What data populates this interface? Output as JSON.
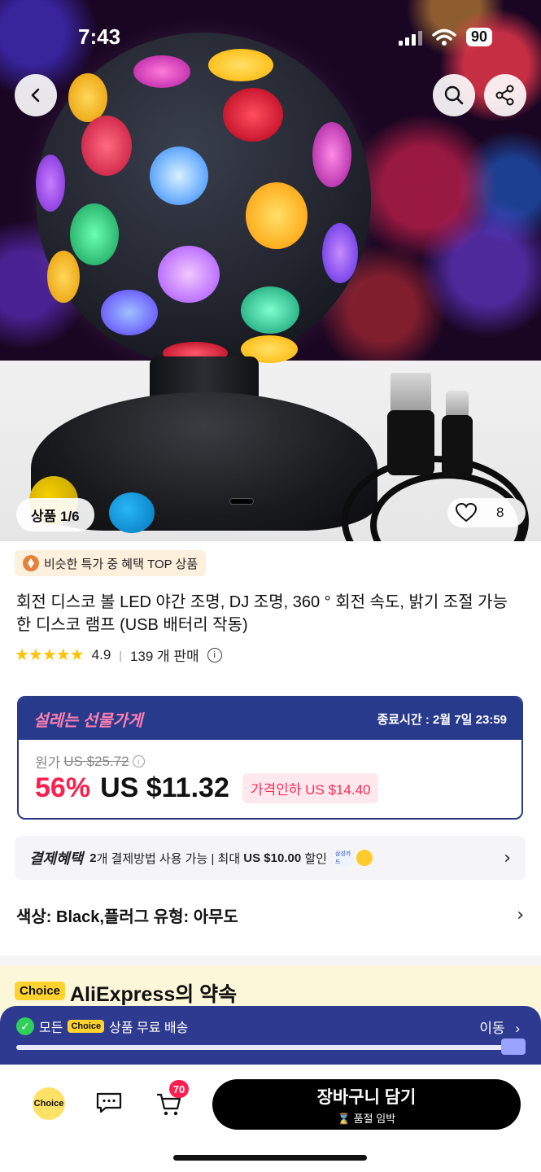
{
  "status_bar": {
    "time": "7:43",
    "battery": "90"
  },
  "hero": {
    "counter": "상품 1/6",
    "wishlist_count": "8"
  },
  "promo_badge": "비슷한 특가 중 혜택 TOP 상품",
  "product": {
    "title": "회전 디스코 볼 LED 야간 조명, DJ 조명, 360 ° 회전 속도, 밝기 조절 가능한 디스코 램프 (USB 배터리 작동)",
    "rating": "4.9",
    "sold": "139 개 판매"
  },
  "deal": {
    "brand": "설레는 선물가게",
    "ends": "종료시간 : 2월 7일 23:59",
    "original_label": "원가",
    "original_price": "US $25.72",
    "discount": "56%",
    "price": "US $11.32",
    "price_drop": "가격인하 US $14.40"
  },
  "payment": {
    "title": "결제혜택",
    "count": "2",
    "text1": "개 결제방법 사용 가능 | 최대 ",
    "amount": "US $10.00",
    "text2": " 할인",
    "card_label": "삼성카드"
  },
  "options": {
    "text": "색상: Black,플러그 유형: 아무도"
  },
  "choice_section": {
    "tag": "Choice",
    "title": "AliExpress의 약속"
  },
  "shipping_banner": {
    "prefix": "모든",
    "tag": "Choice",
    "suffix": "상품 무료 배송",
    "link": "이동",
    "progress": 0.97
  },
  "bottom_bar": {
    "choice_label": "Choice",
    "cart_count": "70",
    "add_to_cart": "장바구니 담기",
    "stock_note": "품절 임박"
  },
  "colors": {
    "deal_navy": "#283a8b",
    "discount_red": "#ff1f4e",
    "choice_yellow": "#ffd22e"
  }
}
